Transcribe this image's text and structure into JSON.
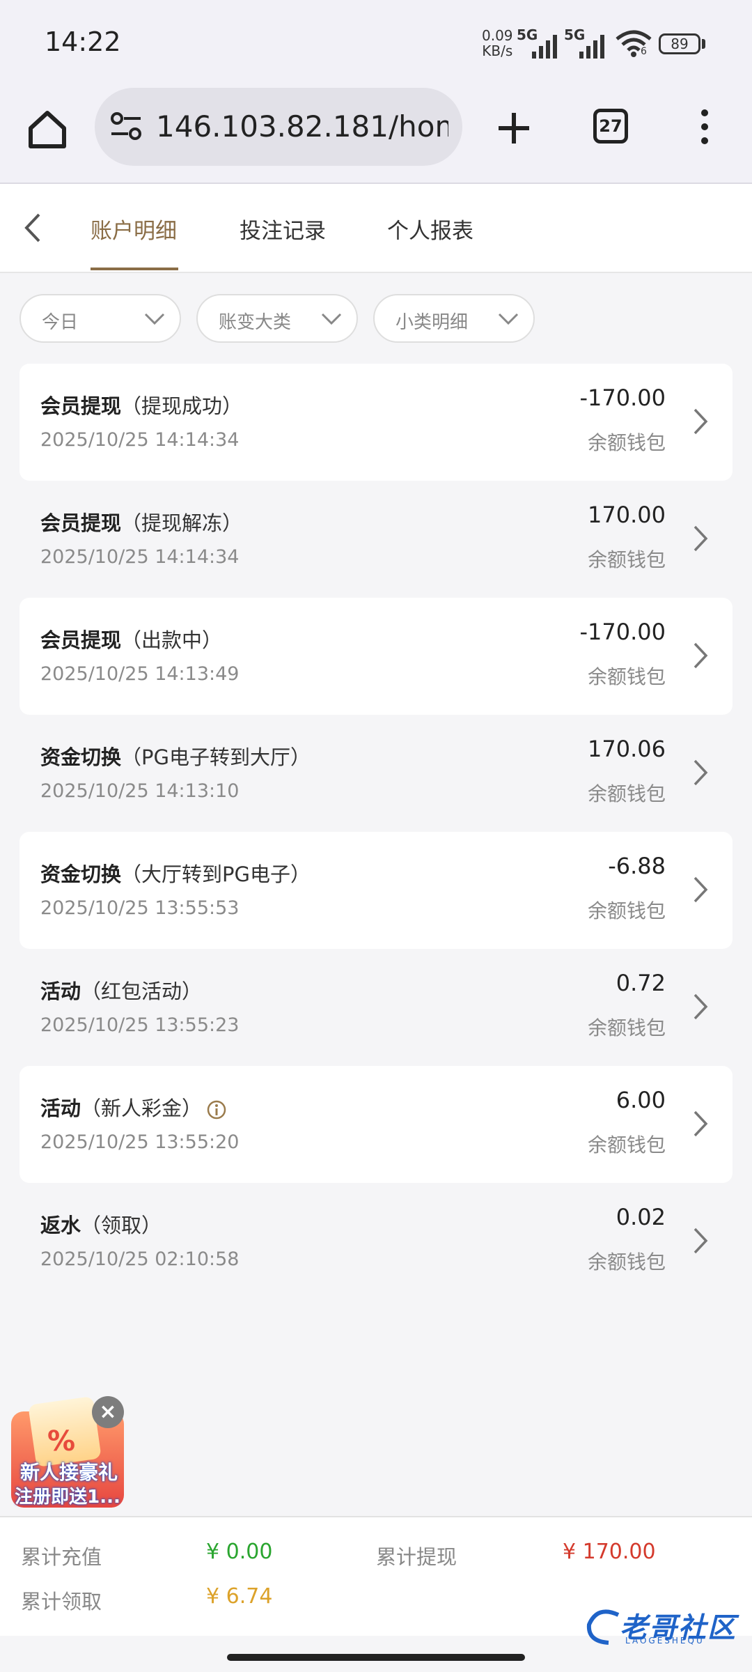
{
  "status_bar": {
    "time": "14:22",
    "net_speed_value": "0.09",
    "net_speed_unit": "KB/s",
    "signal1_label": "5G",
    "signal2_label": "5G",
    "wifi_sub": "6",
    "battery": "89"
  },
  "browser": {
    "url": "146.103.82.181/home/",
    "tab_count": "27"
  },
  "nav": {
    "tabs": [
      {
        "label": "账户明细",
        "active": true
      },
      {
        "label": "投注记录",
        "active": false
      },
      {
        "label": "个人报表",
        "active": false
      }
    ]
  },
  "filters": {
    "date": "今日",
    "category": "账变大类",
    "subcategory": "小类明细"
  },
  "records": [
    {
      "title": "会员提现",
      "sub": "（提现成功）",
      "time": "2025/10/25 14:14:34",
      "amount": "-170.00",
      "wallet": "余额钱包"
    },
    {
      "title": "会员提现",
      "sub": "（提现解冻）",
      "time": "2025/10/25 14:14:34",
      "amount": "170.00",
      "wallet": "余额钱包"
    },
    {
      "title": "会员提现",
      "sub": "（出款中）",
      "time": "2025/10/25 14:13:49",
      "amount": "-170.00",
      "wallet": "余额钱包"
    },
    {
      "title": "资金切换",
      "sub": "（PG电子转到大厅）",
      "time": "2025/10/25 14:13:10",
      "amount": "170.06",
      "wallet": "余额钱包"
    },
    {
      "title": "资金切换",
      "sub": "（大厅转到PG电子）",
      "time": "2025/10/25 13:55:53",
      "amount": "-6.88",
      "wallet": "余额钱包"
    },
    {
      "title": "活动",
      "sub": "（红包活动）",
      "time": "2025/10/25 13:55:23",
      "amount": "0.72",
      "wallet": "余额钱包"
    },
    {
      "title": "活动",
      "sub": "（新人彩金）",
      "time": "2025/10/25 13:55:20",
      "amount": "6.00",
      "wallet": "余额钱包",
      "info": true
    },
    {
      "title": "返水",
      "sub": "（领取）",
      "time": "2025/10/25 02:10:58",
      "amount": "0.02",
      "wallet": "余额钱包"
    }
  ],
  "promo": {
    "line1": "新人接豪礼",
    "line2": "注册即送1...",
    "close_icon": "close-icon"
  },
  "summary": {
    "total_deposit_label": "累计充值",
    "total_deposit_value": "¥ 0.00",
    "total_withdraw_label": "累计提现",
    "total_withdraw_value": "¥ 170.00",
    "total_claim_label": "累计领取",
    "total_claim_value": "¥ 6.74"
  },
  "watermark": {
    "text": "老哥社区",
    "sub": "LAOGESHEQU"
  },
  "colors": {
    "accent": "#8a6d46",
    "deposit": "#2aa52f",
    "withdraw": "#d43a2c",
    "claim": "#dca22a"
  }
}
